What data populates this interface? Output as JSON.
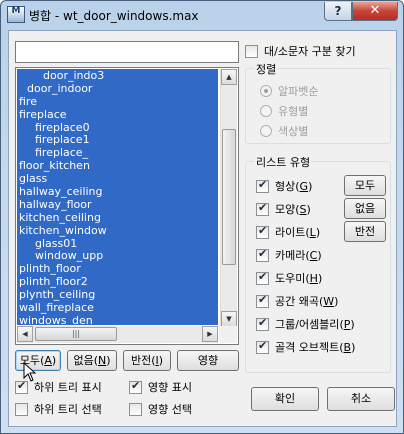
{
  "window": {
    "title": "병합 - wt_door_windows.max",
    "help_label": "?",
    "close_label": "✕",
    "icon_label": "M"
  },
  "filter": {
    "value": "",
    "case_label": "대/소문자 구분 찾기"
  },
  "list": {
    "items": [
      {
        "label": "door_indo3",
        "indent": 3
      },
      {
        "label": "door_indoor",
        "indent": 1
      },
      {
        "label": "fire",
        "indent": 0
      },
      {
        "label": "fireplace",
        "indent": 0
      },
      {
        "label": "fireplace0",
        "indent": 2
      },
      {
        "label": "fireplace1",
        "indent": 2
      },
      {
        "label": "fireplace_",
        "indent": 2
      },
      {
        "label": "floor_kitchen",
        "indent": 0
      },
      {
        "label": "glass",
        "indent": 0
      },
      {
        "label": "hallway_ceiling",
        "indent": 0
      },
      {
        "label": "hallway_floor",
        "indent": 0
      },
      {
        "label": "kitchen_ceiling",
        "indent": 0
      },
      {
        "label": "kitchen_window",
        "indent": 0
      },
      {
        "label": "glass01",
        "indent": 2
      },
      {
        "label": "window_upp",
        "indent": 2
      },
      {
        "label": "plinth_floor",
        "indent": 0
      },
      {
        "label": "plinth_floor2",
        "indent": 0
      },
      {
        "label": "plynth_ceiling",
        "indent": 0
      },
      {
        "label": "wall_fireplace",
        "indent": 0
      },
      {
        "label": "windows_den",
        "indent": 0
      }
    ]
  },
  "sort": {
    "title": "정렬",
    "options": [
      {
        "label": "알파벳순",
        "selected": true
      },
      {
        "label": "유형별",
        "selected": false
      },
      {
        "label": "색상별",
        "selected": false
      }
    ]
  },
  "types": {
    "title": "리스트 유형",
    "items": [
      {
        "label": "형상",
        "key": "G",
        "checked": true
      },
      {
        "label": "모양",
        "key": "S",
        "checked": true
      },
      {
        "label": "라이트",
        "key": "L",
        "checked": true
      },
      {
        "label": "카메라",
        "key": "C",
        "checked": true
      },
      {
        "label": "도우미",
        "key": "H",
        "checked": true
      },
      {
        "label": "공간 왜곡",
        "key": "W",
        "checked": true
      },
      {
        "label": "그룹/어셈블리",
        "key": "P",
        "checked": true
      },
      {
        "label": "골격 오브젝트",
        "key": "B",
        "checked": true
      }
    ],
    "all_label": "모두",
    "none_label": "없음",
    "invert_label": "반전"
  },
  "list_buttons": {
    "all": {
      "label": "모두",
      "key": "A"
    },
    "none": {
      "label": "없음",
      "key": "N"
    },
    "invert": {
      "label": "반전",
      "key": "I"
    },
    "influence": {
      "label": "영향"
    }
  },
  "options": {
    "show_subtree": {
      "label": "하위 트리 표시",
      "checked": true
    },
    "show_influence": {
      "label": "영향 표시",
      "checked": true
    },
    "select_subtree": {
      "label": "하위 트리 선택",
      "checked": false
    },
    "select_influence": {
      "label": "영향 선택",
      "checked": false
    }
  },
  "dialog": {
    "ok_label": "확인",
    "cancel_label": "취소"
  }
}
